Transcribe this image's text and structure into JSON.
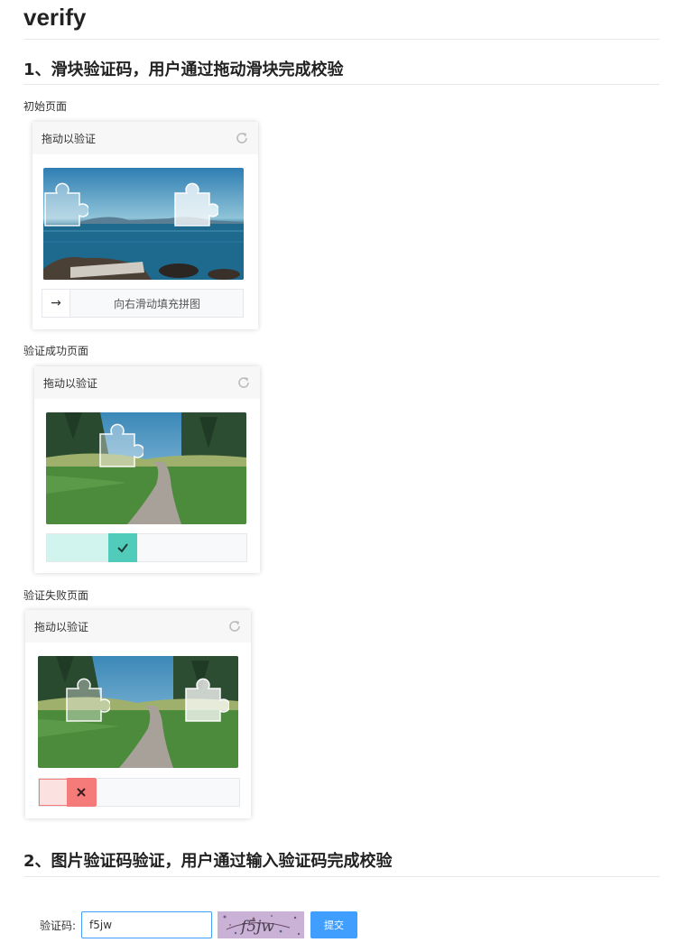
{
  "page": {
    "title": "verify"
  },
  "section1": {
    "heading": "1、滑块验证码，用户通过拖动滑块完成校验",
    "initial": {
      "label": "初始页面",
      "card_title": "拖动以验证",
      "slider_hint": "向右滑动填充拼图"
    },
    "success": {
      "label": "验证成功页面",
      "card_title": "拖动以验证"
    },
    "failure": {
      "label": "验证失败页面",
      "card_title": "拖动以验证"
    }
  },
  "section2": {
    "heading": "2、图片验证码验证，用户通过输入验证码完成校验",
    "field_label": "验证码:",
    "input_value": "f5jw",
    "captcha_text": "f5jw",
    "submit_label": "提交"
  },
  "colors": {
    "accent": "#409eff",
    "success": "#52ccba",
    "success_fill": "#d2f4ef",
    "error": "#f57a7a",
    "error_fill": "#fce1e1"
  },
  "icons": {
    "refresh": "refresh-icon",
    "arrow": "arrow-right-icon",
    "check": "check-icon",
    "cross": "close-icon",
    "puzzle": "puzzle-piece-icon"
  }
}
